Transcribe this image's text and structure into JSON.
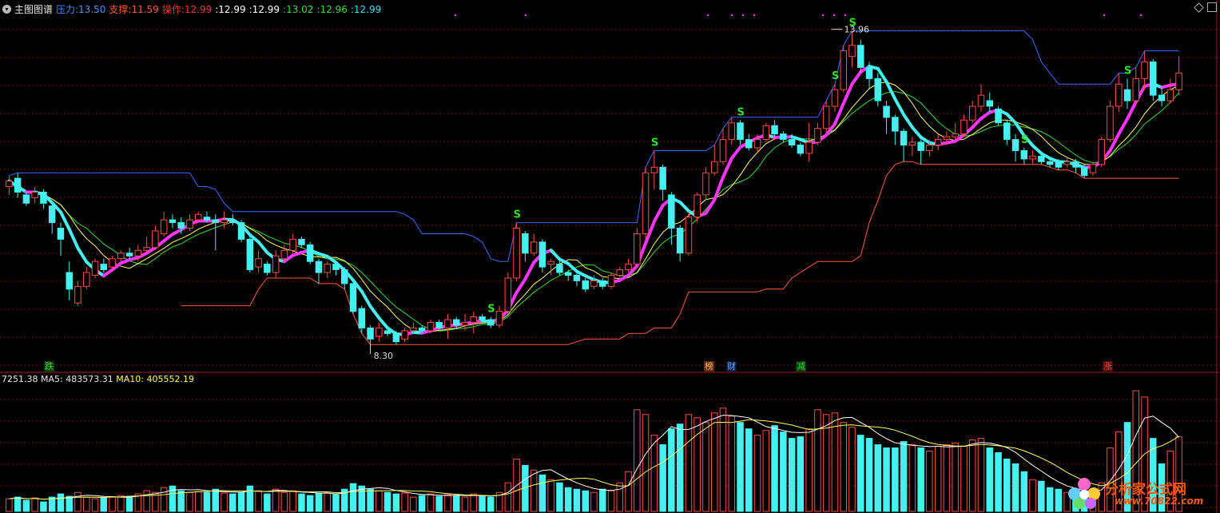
{
  "header": {
    "title": "主图图谱",
    "items": [
      {
        "label": "压力",
        "value": "13.50",
        "color": "#4a90ff"
      },
      {
        "label": "支撑",
        "value": "11.59",
        "color": "#ff5a3a"
      },
      {
        "label": "操作",
        "value": "12.99",
        "color": "#ff3030"
      },
      {
        "label": "",
        "value": "12.99",
        "color": "#ffffff"
      },
      {
        "label": "",
        "value": "12.99",
        "color": "#ffffff"
      },
      {
        "label": "",
        "value": "13.02",
        "color": "#33dd33"
      },
      {
        "label": "",
        "value": "12.96",
        "color": "#33dd33"
      },
      {
        "label": "",
        "value": "12.99",
        "color": "#33e0ff"
      }
    ]
  },
  "volume_header": {
    "vol": "7251.38",
    "ma5_label": "MA5:",
    "ma5": "483573.31",
    "ma10_label": "MA10:",
    "ma10": "405552.19"
  },
  "markers": {
    "high_label": "13.96",
    "low_label": "8.30",
    "signal": "S"
  },
  "events": [
    {
      "text": "跌",
      "color": "#33dd33",
      "bg": "#0a3a0a"
    },
    {
      "text": "榜",
      "color": "#ffb060",
      "bg": "#5a2a10"
    },
    {
      "text": "财",
      "color": "#6aa8ff",
      "bg": "#0a1a40"
    },
    {
      "text": "减",
      "color": "#33dd33",
      "bg": "#0a3a0a"
    },
    {
      "text": "涨",
      "color": "#ff4040",
      "bg": "#4a0a0a"
    }
  ],
  "logo": {
    "name": "分析家公式网",
    "url": "www.70822.com"
  },
  "colors": {
    "up": "#ff4a4a",
    "down": "#44f0f0",
    "grid": "#7a1010",
    "ma_main": "#ff33ff",
    "ma_cyan": "#44f0f0",
    "ma_yellow": "#ffff66",
    "ma_green": "#33dd33",
    "resist": "#3a6aff",
    "support": "#ff5a3a"
  },
  "chart_data": {
    "type": "candlestick",
    "price_range": [
      8.0,
      14.2
    ],
    "candles": [
      [
        11.15,
        11.25,
        11.35,
        11.0
      ],
      [
        11.3,
        11.05,
        11.4,
        10.95
      ],
      [
        11.0,
        10.85,
        11.05,
        10.8
      ],
      [
        10.95,
        11.05,
        11.15,
        10.85
      ],
      [
        11.05,
        10.85,
        11.1,
        10.75
      ],
      [
        10.8,
        10.5,
        10.85,
        10.3
      ],
      [
        10.4,
        10.2,
        10.5,
        9.9
      ],
      [
        9.6,
        9.3,
        9.8,
        9.1
      ],
      [
        9.05,
        9.35,
        9.45,
        9.0
      ],
      [
        9.35,
        9.6,
        9.7,
        9.3
      ],
      [
        9.55,
        9.8,
        9.85,
        9.5
      ],
      [
        9.75,
        9.65,
        9.85,
        9.6
      ],
      [
        9.7,
        9.85,
        9.9,
        9.65
      ],
      [
        9.85,
        9.95,
        10.0,
        9.8
      ],
      [
        9.95,
        9.9,
        10.05,
        9.85
      ],
      [
        9.9,
        10.0,
        10.1,
        9.8
      ],
      [
        10.0,
        10.05,
        10.25,
        9.95
      ],
      [
        10.05,
        10.35,
        10.45,
        10.0
      ],
      [
        10.3,
        10.55,
        10.7,
        10.25
      ],
      [
        10.55,
        10.5,
        10.65,
        10.4
      ],
      [
        10.5,
        10.4,
        10.6,
        10.3
      ],
      [
        10.4,
        10.55,
        10.65,
        10.35
      ],
      [
        10.55,
        10.65,
        10.7,
        10.5
      ],
      [
        10.6,
        10.55,
        10.7,
        10.5
      ],
      [
        10.55,
        10.5,
        10.65,
        10.0
      ],
      [
        10.5,
        10.55,
        10.7,
        10.4
      ],
      [
        10.55,
        10.5,
        10.65,
        10.45
      ],
      [
        10.5,
        10.2,
        10.55,
        10.15
      ],
      [
        10.2,
        9.65,
        10.25,
        9.6
      ],
      [
        9.7,
        9.85,
        10.0,
        9.6
      ],
      [
        9.75,
        9.6,
        9.8,
        9.55
      ],
      [
        9.6,
        9.9,
        10.0,
        9.5
      ],
      [
        9.85,
        10.0,
        10.1,
        9.8
      ],
      [
        10.0,
        10.2,
        10.3,
        9.95
      ],
      [
        10.2,
        10.1,
        10.25,
        10.05
      ],
      [
        10.1,
        9.8,
        10.15,
        9.75
      ],
      [
        9.8,
        9.6,
        9.85,
        9.4
      ],
      [
        9.6,
        9.75,
        9.8,
        9.5
      ],
      [
        9.75,
        9.65,
        9.8,
        9.55
      ],
      [
        9.65,
        9.4,
        9.7,
        9.3
      ],
      [
        9.4,
        8.9,
        9.45,
        8.85
      ],
      [
        8.95,
        8.6,
        9.0,
        8.5
      ],
      [
        8.6,
        8.4,
        8.65,
        8.3
      ],
      [
        8.45,
        8.6,
        8.7,
        8.35
      ],
      [
        8.55,
        8.5,
        8.6,
        8.45
      ],
      [
        8.5,
        8.35,
        8.55,
        8.3
      ],
      [
        8.4,
        8.55,
        8.6,
        8.35
      ],
      [
        8.55,
        8.6,
        8.7,
        8.5
      ],
      [
        8.6,
        8.55,
        8.65,
        8.5
      ],
      [
        8.55,
        8.7,
        8.75,
        8.5
      ],
      [
        8.7,
        8.6,
        8.75,
        8.55
      ],
      [
        8.6,
        8.75,
        8.85,
        8.4
      ],
      [
        8.75,
        8.65,
        8.8,
        8.6
      ],
      [
        8.65,
        8.7,
        8.85,
        8.55
      ],
      [
        8.7,
        8.8,
        8.9,
        8.5
      ],
      [
        8.8,
        8.75,
        8.85,
        8.7
      ],
      [
        8.75,
        8.65,
        8.8,
        8.6
      ],
      [
        8.65,
        8.9,
        9.0,
        8.6
      ],
      [
        8.9,
        9.5,
        9.6,
        8.85
      ],
      [
        9.5,
        10.4,
        10.5,
        9.45
      ],
      [
        10.3,
        9.95,
        10.35,
        9.8
      ],
      [
        9.95,
        10.15,
        10.3,
        9.9
      ],
      [
        10.15,
        9.7,
        10.2,
        9.6
      ],
      [
        9.75,
        9.8,
        9.85,
        9.55
      ],
      [
        9.75,
        9.6,
        9.85,
        9.55
      ],
      [
        9.6,
        9.55,
        9.65,
        9.45
      ],
      [
        9.55,
        9.45,
        9.6,
        9.35
      ],
      [
        9.45,
        9.3,
        9.5,
        9.25
      ],
      [
        9.35,
        9.45,
        9.55,
        9.3
      ],
      [
        9.45,
        9.35,
        9.5,
        9.3
      ],
      [
        9.35,
        9.55,
        9.6,
        9.3
      ],
      [
        9.55,
        9.65,
        9.7,
        9.5
      ],
      [
        9.65,
        9.75,
        9.85,
        9.6
      ],
      [
        9.75,
        10.3,
        10.4,
        9.7
      ],
      [
        10.3,
        11.4,
        11.5,
        10.2
      ],
      [
        11.4,
        11.5,
        11.8,
        11.1
      ],
      [
        11.5,
        11.1,
        11.55,
        10.9
      ],
      [
        11.0,
        10.4,
        11.05,
        10.1
      ],
      [
        10.4,
        9.95,
        10.45,
        9.8
      ],
      [
        9.95,
        10.6,
        10.7,
        9.9
      ],
      [
        10.6,
        11.0,
        11.05,
        10.5
      ],
      [
        11.0,
        11.4,
        11.5,
        10.9
      ],
      [
        11.4,
        11.6,
        11.9,
        11.35
      ],
      [
        11.6,
        12.0,
        12.2,
        11.55
      ],
      [
        12.0,
        12.3,
        12.4,
        11.9
      ],
      [
        12.3,
        12.0,
        12.35,
        11.9
      ],
      [
        12.0,
        11.85,
        12.1,
        11.8
      ],
      [
        11.85,
        12.0,
        12.1,
        11.75
      ],
      [
        12.0,
        12.25,
        12.3,
        11.95
      ],
      [
        12.25,
        12.1,
        12.35,
        12.0
      ],
      [
        12.1,
        12.0,
        12.15,
        11.95
      ],
      [
        12.0,
        11.9,
        12.1,
        11.85
      ],
      [
        11.9,
        11.75,
        11.95,
        11.7
      ],
      [
        11.75,
        11.95,
        12.3,
        11.6
      ],
      [
        11.95,
        12.2,
        12.3,
        11.9
      ],
      [
        12.2,
        12.6,
        12.7,
        12.1
      ],
      [
        12.6,
        12.9,
        13.0,
        12.5
      ],
      [
        12.9,
        13.6,
        13.7,
        12.85
      ],
      [
        13.5,
        13.7,
        13.96,
        13.3
      ],
      [
        13.7,
        13.3,
        13.8,
        13.2
      ],
      [
        13.3,
        13.1,
        13.4,
        12.9
      ],
      [
        13.1,
        12.7,
        13.2,
        12.6
      ],
      [
        12.6,
        12.4,
        12.7,
        12.1
      ],
      [
        12.4,
        12.15,
        12.45,
        11.9
      ],
      [
        12.15,
        11.9,
        12.2,
        11.6
      ],
      [
        11.9,
        11.95,
        12.05,
        11.7
      ],
      [
        11.95,
        11.8,
        12.0,
        11.55
      ],
      [
        11.8,
        11.9,
        12.0,
        11.7
      ],
      [
        11.9,
        12.0,
        12.1,
        11.8
      ],
      [
        12.0,
        12.05,
        12.15,
        11.9
      ],
      [
        12.05,
        12.1,
        12.3,
        12.0
      ],
      [
        12.1,
        12.35,
        12.45,
        12.05
      ],
      [
        12.35,
        12.6,
        12.7,
        12.3
      ],
      [
        12.6,
        12.8,
        13.0,
        12.5
      ],
      [
        12.7,
        12.6,
        12.85,
        12.5
      ],
      [
        12.55,
        12.3,
        12.6,
        12.25
      ],
      [
        12.3,
        12.0,
        12.35,
        11.9
      ],
      [
        12.0,
        11.8,
        12.1,
        11.6
      ],
      [
        11.8,
        11.65,
        11.85,
        11.55
      ],
      [
        11.65,
        11.7,
        11.8,
        11.55
      ],
      [
        11.7,
        11.6,
        11.75,
        11.55
      ],
      [
        11.6,
        11.55,
        11.65,
        11.5
      ],
      [
        11.6,
        11.5,
        11.65,
        11.45
      ],
      [
        11.55,
        11.6,
        11.7,
        11.5
      ],
      [
        11.6,
        11.5,
        11.65,
        11.4
      ],
      [
        11.5,
        11.35,
        11.55,
        11.3
      ],
      [
        11.4,
        11.55,
        11.6,
        11.35
      ],
      [
        11.55,
        12.0,
        12.05,
        11.5
      ],
      [
        12.0,
        12.6,
        12.7,
        11.95
      ],
      [
        12.6,
        13.0,
        13.2,
        12.5
      ],
      [
        12.9,
        12.7,
        13.1,
        12.55
      ],
      [
        12.7,
        13.1,
        13.3,
        12.6
      ],
      [
        13.1,
        13.4,
        13.6,
        12.9
      ],
      [
        13.4,
        12.8,
        13.45,
        12.7
      ],
      [
        12.8,
        12.7,
        12.95,
        12.6
      ],
      [
        12.7,
        12.9,
        13.1,
        12.65
      ],
      [
        12.9,
        13.2,
        13.5,
        12.8
      ]
    ],
    "volume": [
      80000,
      90000,
      70000,
      85000,
      60000,
      90000,
      110000,
      95000,
      120000,
      90000,
      80000,
      85000,
      90000,
      100000,
      95000,
      110000,
      130000,
      120000,
      150000,
      160000,
      130000,
      120000,
      125000,
      120000,
      140000,
      115000,
      110000,
      120000,
      160000,
      130000,
      110000,
      140000,
      120000,
      130000,
      110000,
      100000,
      115000,
      120000,
      105000,
      140000,
      175000,
      160000,
      140000,
      130000,
      120000,
      110000,
      115000,
      90000,
      100000,
      110000,
      95000,
      105000,
      100000,
      90000,
      110000,
      95000,
      90000,
      120000,
      180000,
      330000,
      290000,
      260000,
      230000,
      200000,
      180000,
      150000,
      140000,
      130000,
      120000,
      140000,
      130000,
      180000,
      250000,
      640000,
      610000,
      480000,
      420000,
      520000,
      550000,
      610000,
      590000,
      560000,
      620000,
      650000,
      600000,
      560000,
      520000,
      480000,
      510000,
      540000,
      500000,
      460000,
      470000,
      520000,
      640000,
      610000,
      620000,
      560000,
      530000,
      480000,
      460000,
      420000,
      400000,
      400000,
      440000,
      420000,
      400000,
      380000,
      410000,
      420000,
      430000,
      410000,
      450000,
      460000,
      400000,
      370000,
      330000,
      300000,
      250000,
      200000,
      190000,
      150000,
      140000,
      120000,
      130000,
      110000,
      140000,
      180000,
      400000,
      500000,
      560000,
      760000,
      720000,
      460000,
      300000,
      380000,
      470000
    ],
    "lines": {
      "ma_main": [],
      "ma_cyan": [],
      "resist": [],
      "support": []
    },
    "high_point": {
      "index": 98,
      "value": 13.96
    },
    "low_point": {
      "index": 42,
      "value": 8.3
    }
  }
}
